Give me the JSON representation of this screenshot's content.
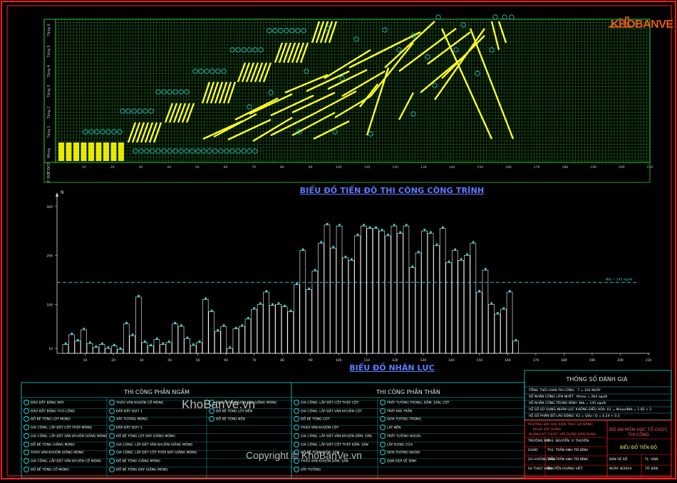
{
  "schedule": {
    "title": "BIỂU ĐỒ TIẾN ĐỘ THI CÔNG CÔNG TRÌNH",
    "floor_labels": [
      "Móng",
      "Tầng 1",
      "Tầng 2",
      "Tầng 3",
      "Tầng 4",
      "Tầng 5",
      "Tầng 6",
      "P. ĐOT",
      "P. ĐOT"
    ],
    "x_ticks": [
      "10",
      "20",
      "30",
      "40",
      "50",
      "60",
      "70",
      "80",
      "90",
      "100",
      "110",
      "120",
      "130",
      "140",
      "150",
      "160",
      "170",
      "180",
      "190",
      "200",
      "210"
    ]
  },
  "labor": {
    "title": "BIỂU ĐỒ NHÂN LỰC",
    "y_axis_label": "N",
    "y_ticks": [
      "10",
      "100",
      "200",
      "300"
    ],
    "x_ticks": [
      "10",
      "20",
      "30",
      "40",
      "50",
      "60",
      "70",
      "80",
      "90",
      "100",
      "110",
      "120",
      "130",
      "140",
      "150",
      "160",
      "170",
      "180",
      "190",
      "200",
      "210"
    ],
    "avg_label": "Ntb = 145 người"
  },
  "chart_data": {
    "type": "bar",
    "title": "BIỂU ĐỒ NHÂN LỰC",
    "ylabel": "N",
    "ylim": [
      0,
      320
    ],
    "xlim": [
      0,
      210
    ],
    "average_line": 145,
    "values": [
      18,
      38,
      25,
      48,
      20,
      12,
      18,
      10,
      15,
      8,
      60,
      36,
      115,
      22,
      15,
      28,
      18,
      22,
      60,
      55,
      30,
      16,
      22,
      110,
      85,
      45,
      55,
      10,
      50,
      55,
      70,
      90,
      100,
      125,
      98,
      100,
      95,
      85,
      140,
      210,
      130,
      168,
      225,
      262,
      215,
      260,
      195,
      190,
      240,
      260,
      255,
      255,
      250,
      240,
      260,
      245,
      260,
      175,
      205,
      250,
      245,
      220,
      255,
      185,
      210,
      190,
      200,
      225,
      125,
      170,
      100,
      80,
      90,
      125,
      25
    ]
  },
  "footer": {
    "left_panel_title": "THI CÔNG PHẦN NGẦM",
    "right_panel_title": "THI CÔNG PHẦN THÂN",
    "eval_title": "THÔNG SỐ ĐÁNH GIÁ",
    "eval_lines": [
      "TỔNG THỜI GIAN THI CÔNG : T = 162 NGÀY",
      "SỐ NHÂN CÔNG LỚN NHẤT : Nmax = 264 người",
      "SỐ NHÂN CÔNG TRUNG BÌNH: Ntb = 145 người",
      "HỆ SỐ SỬ DỤNG NHÂN LỰC KHÔNG ĐIỀU HÒA: K1 = Nmax/Ntb = 1.82 < 2",
      "HỆ SỐ PHÂN BỐ LAO ĐỘNG: K2 = Qdư / Q = 0.24 < 0.3"
    ],
    "ngam_items": [
      "ĐÀO ĐẤT BẰNG MÁY",
      "ĐÀO ĐẤT BẰNG THỦ CÔNG",
      "ĐỔ BÊ TÔNG LÓT MÓNG",
      "GIA CÔNG, LẮP ĐẶT CỐT THÉP MÓNG",
      "GIA CÔNG, LẮP ĐẶT VÁN KHUÔN GIẰNG MÓNG",
      "ĐỔ BÊ TÔNG GIẰNG MÓNG",
      "THÁO VÁN KHUÔN GIẰNG MÓNG",
      "GIA CÔNG, LẮP ĐẶT VÁN KHUÔN CỔ MÓNG",
      "ĐỔ BÊ TÔNG CỔ MÓNG",
      "THÁO VÁN KHUÔN CỔ MÓNG",
      "ĐẮP ĐẤT ĐỢT 1",
      "XÂY TƯỜNG MÓNG",
      "ĐẮP ĐẤT ĐỢT 2",
      "ĐỔ BÊ TÔNG LÓT ĐÁY GIẰNG MÓNG",
      "GIA CÔNG, LẮP ĐẶT VÁN KHUÔN GIẰNG MÓNG",
      "GIA CÔNG, LẮP ĐẶT CỐT THÉP ĐÁY GIẰNG MÓNG",
      "ĐỔ BÊ TÔNG GIẰNG MÓNG",
      "ĐỔ BÊ TÔNG ĐÁY GIẰNG MÓNG",
      "THÁO VÁN KHUÔN ĐÁY GIẰNG MÓNG",
      "ĐỔ BÊ TÔNG LÓT NỀN",
      "ĐỔ BÊ TÔNG NỀN"
    ],
    "than_items": [
      "GIA CÔNG, LẮP ĐẶT CỐT THÉP CỘT",
      "GIA CÔNG, LẮP ĐẶT VÁN KHUÔN CỘT",
      "ĐỔ BÊ TÔNG CỘT",
      "THÁO VÁN KHUÔN CỘT",
      "GIA CÔNG, LẮP ĐẶT VÁN KHUÔN DẦM, SÀN",
      "GIA CÔNG, LẮP ĐẶT CỐT THÉP DẦM, SÀN",
      "ĐỔ BÊ TÔNG DẦM, SÀN",
      "THÁO VÁN KHUÔN DẦM, SÀN",
      "XÂY TƯỜNG",
      "TRÁT TƯỜNG TRONG, DẦM, SÀN, CỘT",
      "TRÁT MÁI TRẦN",
      "SƠN TƯỜNG TRONG",
      "LÁT NỀN",
      "TRÁT TƯỜNG NGOÀI",
      "LẮP DỰNG CỬA",
      "SƠN TƯỜNG NGOÀI",
      "DỌN DẸP VỆ SINH"
    ],
    "title_block": {
      "school": "TRƯỜNG ĐẠI HỌC KIẾN TRÚC ĐÀ NẴNG",
      "class_line": "KHOA XÂY DỰNG",
      "dept_line": "NGÀNH KỸ THUẬT XÂY DỰNG DÂN DỤNG",
      "rows": [
        [
          "TRƯỞNG BM",
          "ThS. NGUYỄN .V. THUYÊN"
        ],
        [
          "GVHD",
          "ThS. TRẦN ANH TRÍ BÌNH"
        ],
        [
          "GV HƯỚNG DẪN",
          "ThS. TRẦN ANH TRÍ BÌNH"
        ],
        [
          "SV THỰC HIỆN",
          "NGUYỄN HOÀNG VIỆT"
        ]
      ],
      "project_title": "ĐỒ ÁN MÔN HỌC TỔ CHỨC THI CÔNG",
      "drawing_title": "BIỂU ĐỒ TIẾN ĐỘ",
      "scale_label": "TL: VĐN",
      "sheet_label": "TỜ BẢN",
      "date_label": "BẢN VẼ SỐ",
      "ngay_label": "NGÀY: 8/2019"
    }
  },
  "watermarks": {
    "logo_text": "KHOBANVE",
    "site": "KhoBanVe.vn",
    "copyright": "Copyright © KhoBanVe.vn"
  }
}
